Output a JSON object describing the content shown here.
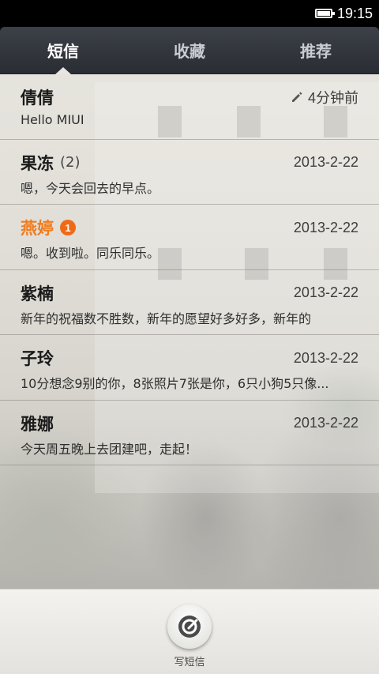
{
  "status_bar": {
    "time": "19:15",
    "battery_level": 1.0
  },
  "tabs": [
    {
      "label": "短信",
      "active": true
    },
    {
      "label": "收藏",
      "active": false
    },
    {
      "label": "推荐",
      "active": false
    }
  ],
  "messages": [
    {
      "sender": "倩倩",
      "count": "",
      "unread_badge": "",
      "time": "4分钟前",
      "has_draft_icon": true,
      "preview": "Hello MIUI"
    },
    {
      "sender": "果冻",
      "count": "(2)",
      "unread_badge": "",
      "time": "2013-2-22",
      "has_draft_icon": false,
      "preview": "嗯，今天会回去的早点。"
    },
    {
      "sender": "燕婷",
      "count": "",
      "unread_badge": "1",
      "time": "2013-2-22",
      "has_draft_icon": false,
      "preview": "嗯。收到啦。同乐同乐。"
    },
    {
      "sender": "紫楠",
      "count": "",
      "unread_badge": "",
      "time": "2013-2-22",
      "has_draft_icon": false,
      "preview": "新年的祝福数不胜数，新年的愿望好多好多，新年的"
    },
    {
      "sender": "子玲",
      "count": "",
      "unread_badge": "",
      "time": "2013-2-22",
      "has_draft_icon": false,
      "preview": "10分想念9别的你，8张照片7张是你，6只小狗5只像..."
    },
    {
      "sender": "雅娜",
      "count": "",
      "unread_badge": "",
      "time": "2013-2-22",
      "has_draft_icon": false,
      "preview": "今天周五晚上去团建吧，走起！"
    }
  ],
  "bottom": {
    "compose_label": "写短信",
    "compose_icon": "compose-icon"
  },
  "colors": {
    "unread_accent": "#f07c1e",
    "badge": "#f06a16",
    "tab_bar": "#33363c"
  }
}
